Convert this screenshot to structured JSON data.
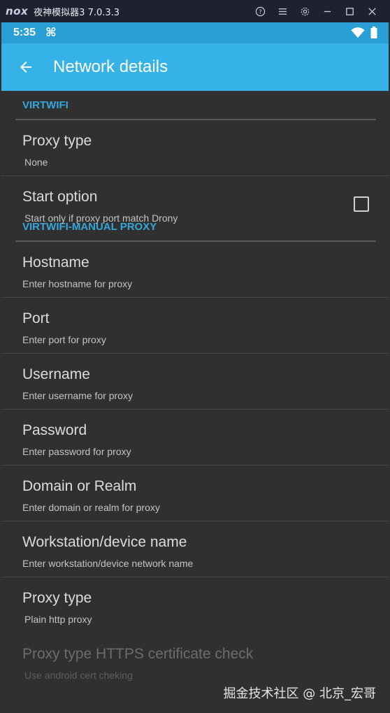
{
  "emulator": {
    "logo": "nox",
    "title": "夜神模拟器3 7.0.3.3",
    "controls": [
      "help-icon",
      "menu-icon",
      "settings-icon",
      "minimize-icon",
      "maximize-icon",
      "close-icon"
    ]
  },
  "status_bar": {
    "time": "5:35",
    "notification_icon": "⌘",
    "icons": [
      "wifi-icon",
      "battery-icon"
    ]
  },
  "app_bar": {
    "title": "Network details",
    "back_icon": "arrow-left-icon"
  },
  "sections": [
    {
      "header": "VIRTWIFI",
      "items": [
        {
          "title": "Proxy type",
          "summary": "None"
        },
        {
          "title": "Start option",
          "summary": "Start only if proxy port match Drony",
          "checkbox": false
        }
      ]
    },
    {
      "header": "VIRTWIFI-MANUAL PROXY",
      "items": [
        {
          "title": "Hostname",
          "summary": "Enter hostname for proxy"
        },
        {
          "title": "Port",
          "summary": "Enter port for proxy"
        },
        {
          "title": "Username",
          "summary": "Enter username for proxy"
        },
        {
          "title": "Password",
          "summary": "Enter password for proxy"
        },
        {
          "title": "Domain or Realm",
          "summary": "Enter domain or realm for proxy"
        },
        {
          "title": "Workstation/device name",
          "summary": "Enter workstation/device network name"
        },
        {
          "title": "Proxy type",
          "summary": "Plain http proxy"
        },
        {
          "title": "Proxy type HTTPS certificate check",
          "summary": "Use android cert cheking",
          "disabled": true
        }
      ]
    }
  ],
  "watermark": "掘金技术社区 @ 北京_宏哥",
  "colors": {
    "status_bar": "#2a9fd6",
    "app_bar": "#35b2e8",
    "background": "#303030",
    "section_header": "#33a8dc"
  }
}
